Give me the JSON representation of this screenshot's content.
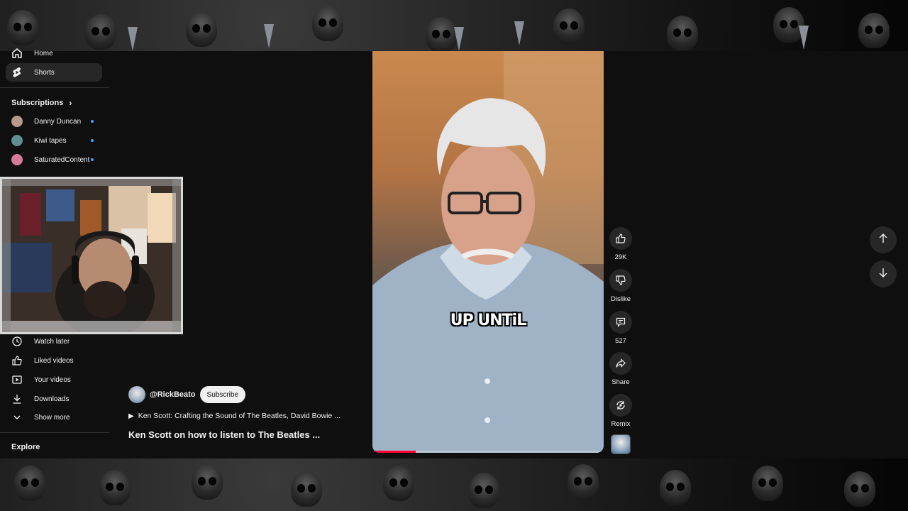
{
  "sidebar": {
    "home_label": "Home",
    "shorts_label": "Shorts",
    "subscriptions_title": "Subscriptions",
    "subscriptions": [
      {
        "name": "Danny Duncan",
        "color": "#b89a8a"
      },
      {
        "name": "Kiwi tapes",
        "color": "#5f8f8e"
      },
      {
        "name": "SaturatedContent",
        "color": "#d67c9a"
      }
    ],
    "library": [
      {
        "label": "Watch later",
        "icon": "clock-icon"
      },
      {
        "label": "Liked videos",
        "icon": "thumbs-up-icon"
      },
      {
        "label": "Your videos",
        "icon": "play-square-icon"
      },
      {
        "label": "Downloads",
        "icon": "download-icon"
      },
      {
        "label": "Show more",
        "icon": "chevron-down-icon"
      }
    ],
    "explore_title": "Explore"
  },
  "video": {
    "caption": "UP UNTiL",
    "progress": 0.18,
    "channel": "@RickBeato",
    "subscribe_label": "Subscribe",
    "related_label": "Ken Scott: Crafting the Sound of The Beatles, David Bowie ...",
    "title": "Ken Scott on how to listen to The Beatles ..."
  },
  "actions": {
    "likes": "29K",
    "dislike": "Dislike",
    "comments": "527",
    "share": "Share",
    "remix": "Remix"
  },
  "colors": {
    "accent": "#ff0033",
    "background": "#0f0f0f",
    "button": "#272727",
    "subscription_dot": "#3ea6ff"
  }
}
